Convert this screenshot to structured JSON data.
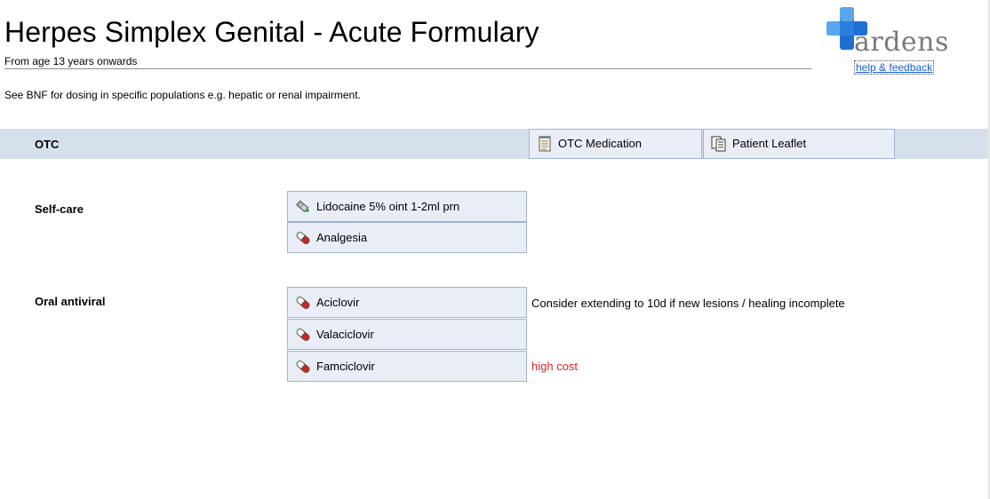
{
  "page": {
    "title": "Herpes Simplex Genital - Acute Formulary",
    "subtitle": "From age 13 years onwards",
    "note": "See BNF for dosing in specific populations e.g. hepatic or renal impairment."
  },
  "brand": {
    "logo_text": "ardens",
    "help_link": "help & feedback",
    "colors": {
      "cross_blue": "#1f6fd0",
      "cross_light": "#5aa7ee"
    }
  },
  "otc": {
    "label": "OTC",
    "buttons": [
      {
        "label": "OTC Medication",
        "icon": "notepad-icon"
      },
      {
        "label": "Patient Leaflet",
        "icon": "leaflet-icon"
      }
    ]
  },
  "sections": [
    {
      "label": "Self-care",
      "items": [
        {
          "label": "Lidocaine 5% oint 1-2ml prn",
          "icon": "ointment-tube-icon",
          "note": ""
        },
        {
          "label": "Analgesia",
          "icon": "pill-capsule-icon",
          "note": ""
        }
      ]
    },
    {
      "label": "Oral antiviral",
      "items": [
        {
          "label": "Aciclovir",
          "icon": "pill-capsule-icon",
          "note": "Consider extending to 10d if new lesions / healing incomplete"
        },
        {
          "label": "Valaciclovir",
          "icon": "pill-capsule-icon",
          "note": ""
        },
        {
          "label": "Famciclovir",
          "icon": "pill-capsule-icon",
          "note": "high cost",
          "note_color": "#e02020"
        }
      ]
    }
  ]
}
